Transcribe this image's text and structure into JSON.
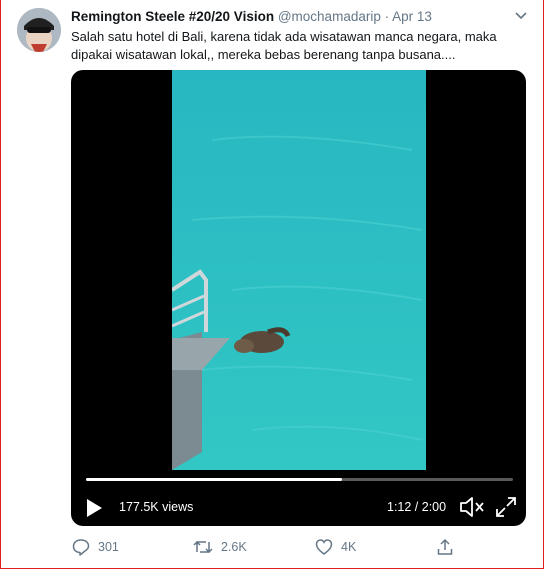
{
  "tweet": {
    "author_name": "Remington Steele #20/20 Vision",
    "handle": "@mochamadarip",
    "separator": "·",
    "date": "Apr 13",
    "text": "Salah satu hotel di Bali, karena tidak ada wisatawan manca negara,  maka dipakai wisatawan lokal,, mereka bebas berenang tanpa busana...."
  },
  "video": {
    "views": "177.5K views",
    "time": "1:12 / 2:00",
    "progress": 0.6
  },
  "actions": {
    "replies": "301",
    "retweets": "2.6K",
    "likes": "4K"
  },
  "icons": {
    "more": "chevron-down-icon",
    "play": "play-icon",
    "volume": "volume-muted-icon",
    "fullscreen": "fullscreen-icon",
    "reply": "reply-icon",
    "retweet": "retweet-icon",
    "like": "heart-icon",
    "share": "share-icon"
  },
  "colors": {
    "muted": "#657786",
    "water": "#27c1c4",
    "frame": "#e02020"
  }
}
